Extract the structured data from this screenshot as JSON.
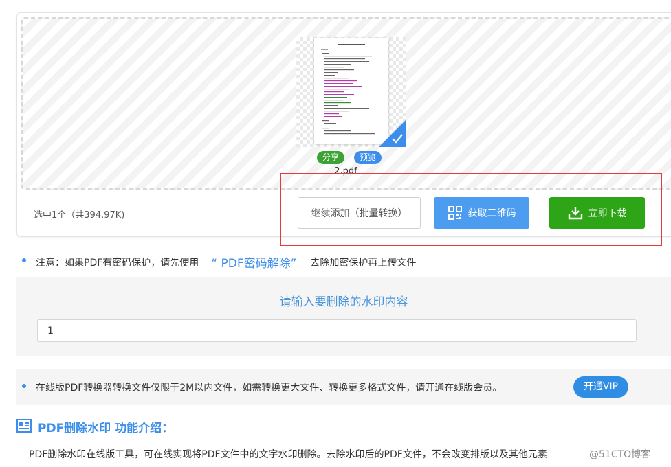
{
  "upload": {
    "file_name": "2.pdf",
    "share_label": "分享",
    "preview_label": "预览",
    "selected_info": "选中1个（共394.97K)",
    "add_more_label": "继续添加（批量转换）",
    "qr_label": "获取二维码",
    "download_label": "立即下载"
  },
  "notice": {
    "prefix": "注意：如果PDF有密码保护，请先使用",
    "link": "“ PDF密码解除”",
    "suffix": "去除加密保护再上传文件"
  },
  "watermark_form": {
    "title": "请输入要删除的水印内容",
    "input_value": "1"
  },
  "vip": {
    "text": "在线版PDF转换器转换文件仅限于2M以内文件，如需转换更大文件、转换更多格式文件，请开通在线版会员。",
    "button_label": "开通VIP"
  },
  "intro": {
    "title": "PDF删除水印 功能介绍：",
    "text": "PDF删除水印在线版工具，可在线实现将PDF文件中的文字水印删除。去除水印后的PDF文件，不会改变排版以及其他元素"
  },
  "site_watermark": "@51CTO博客",
  "colors": {
    "primary_blue": "#3d8eea",
    "green": "#2ea517",
    "highlight_red": "#e23b3b"
  }
}
